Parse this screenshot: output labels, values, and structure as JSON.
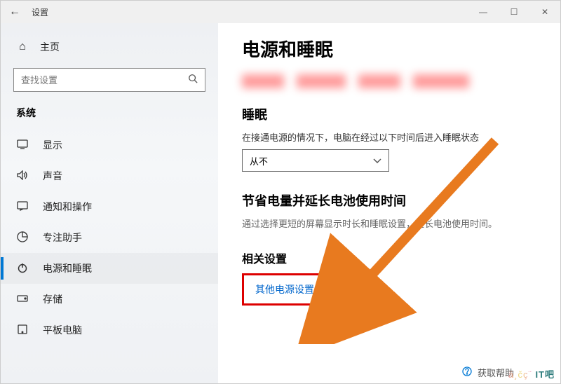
{
  "window": {
    "title": "设置"
  },
  "sidebar": {
    "home_label": "主页",
    "search_placeholder": "查找设置",
    "section_label": "系统",
    "items": [
      {
        "label": "显示"
      },
      {
        "label": "声音"
      },
      {
        "label": "通知和操作"
      },
      {
        "label": "专注助手"
      },
      {
        "label": "电源和睡眠"
      },
      {
        "label": "存储"
      },
      {
        "label": "平板电脑"
      }
    ]
  },
  "content": {
    "page_title": "电源和睡眠",
    "sleep_heading": "睡眠",
    "sleep_desc": "在接通电源的情况下，电脑在经过以下时间后进入睡眠状态",
    "sleep_value": "从不",
    "save_heading": "节省电量并延长电池使用时间",
    "save_desc": "通过选择更短的屏幕显示时长和睡眠设置，延长电池使用时间。",
    "related_heading": "相关设置",
    "related_link": "其他电源设置",
    "help_label": "获取帮助"
  },
  "watermark": {
    "left": "ä¸čç¨",
    "right": "IT吧"
  }
}
